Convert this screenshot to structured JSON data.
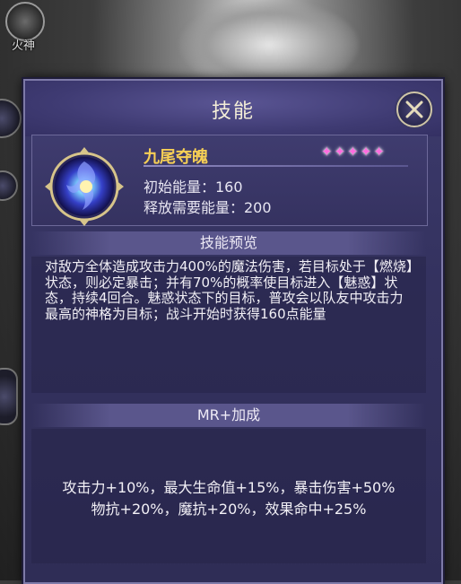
{
  "corner_badge": {
    "label": "火神"
  },
  "panel": {
    "title": "技能",
    "close_icon": "close-x-icon"
  },
  "skill": {
    "name": "九尾夺魄",
    "stars": 5,
    "star_glyph": "✦",
    "initial_energy": "初始能量：160",
    "release_energy": "释放需要能量：200"
  },
  "preview": {
    "header": "技能预览",
    "description": "对敌方全体造成攻击力400%的魔法伤害，若目标处于【燃烧】状态，则必定暴击；并有70%的概率使目标进入【魅惑】状态，持续4回合。魅惑状态下的目标，普攻会以队友中攻击力最高的神格为目标；战斗开始时获得160点能量"
  },
  "mr_bonus": {
    "header": "MR+加成",
    "line1": "攻击力+10%，最大生命值+15%，暴击伤害+50%",
    "line2": "物抗+20%，魔抗+20%，效果命中+25%"
  },
  "colors": {
    "accent_gold": "#f6cf55",
    "star_pink": "#ff6de0",
    "panel_bg": "#34325f"
  }
}
